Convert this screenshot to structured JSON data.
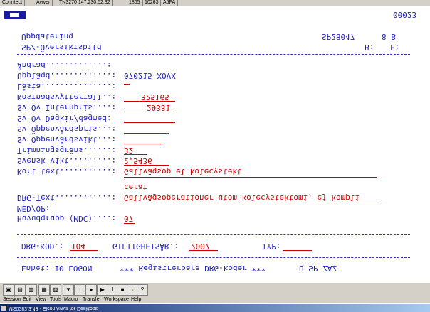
{
  "window": {
    "title": "MS0283.3.43 - Elcon Aviva for Desktops",
    "tabs": [
      "Conntect",
      "Aviver",
      "TN3270 147.230.52.32",
      "1865",
      "10263",
      "A5FA"
    ]
  },
  "menu": [
    "Session",
    "Edit",
    "View",
    "Tools",
    "Macro",
    "Transfer",
    "Workspace",
    "Help"
  ],
  "toolbar_icons": [
    "new-session-icon",
    "open-icon",
    "save-icon",
    "print-icon",
    "copy-icon",
    "paste-icon",
    "send-icon",
    "receive-icon",
    "record-icon",
    "play-icon",
    "pause-icon",
    "stop-icon",
    "step-icon",
    "help-icon"
  ],
  "screen": {
    "status_right": "00023",
    "title1": "Uppdatering",
    "title2": "SPZ-Översiktsbild",
    "code": "SP28047",
    "page": "8 B",
    "b_label": "B:",
    "f_label": "F:",
    "fields": [
      {
        "label": "Ändrad.............:",
        "value": ""
      },
      {
        "label": "Upplägd.............:",
        "value": "070215 XOVX"
      },
      {
        "label": "Låsta...............:",
        "value": ""
      },
      {
        "label": "Kostnadsvyttertall..:",
        "value": "325165"
      },
      {
        "label": "Sv Ov Internpris....:",
        "value": "29331"
      },
      {
        "label": "Sv Ov Dagkir/dagmed:",
        "value": ""
      },
      {
        "label": "Sv Öppenvårdspris...:",
        "value": ""
      },
      {
        "label": "Sv Öppenvårdsvikt...:",
        "value": ""
      },
      {
        "label": "Trimningsgräns......:",
        "value": "32"
      },
      {
        "label": "Svensk vikt.........:",
        "value": "2,5436"
      },
      {
        "label": "Kort text...........:",
        "value": "Gallvägsop el kolecystekt"
      }
    ],
    "drg_label": "DRG-Text............:",
    "drg_value1": "Gallvägsoperationer utom kolecystektomi, ej kompli",
    "drg_value2": "cerat",
    "mdc_label1": "MED/OP:",
    "mdc_label2": "Huvudgrupp (MDC)....:",
    "mdc_value": "07",
    "drg_kod_label": "DRG-KOD.:",
    "drg_kod_value": "104",
    "giltighet_label": "GILTIGHETSÅR.:",
    "giltighet_value": "2007",
    "typ_label": "TYP:",
    "footer_left": "Enhet: 10 LOGON",
    "footer_mid": "*** Registrerbara DRG-koder ***",
    "footer_right": "U SP ZAZ"
  }
}
